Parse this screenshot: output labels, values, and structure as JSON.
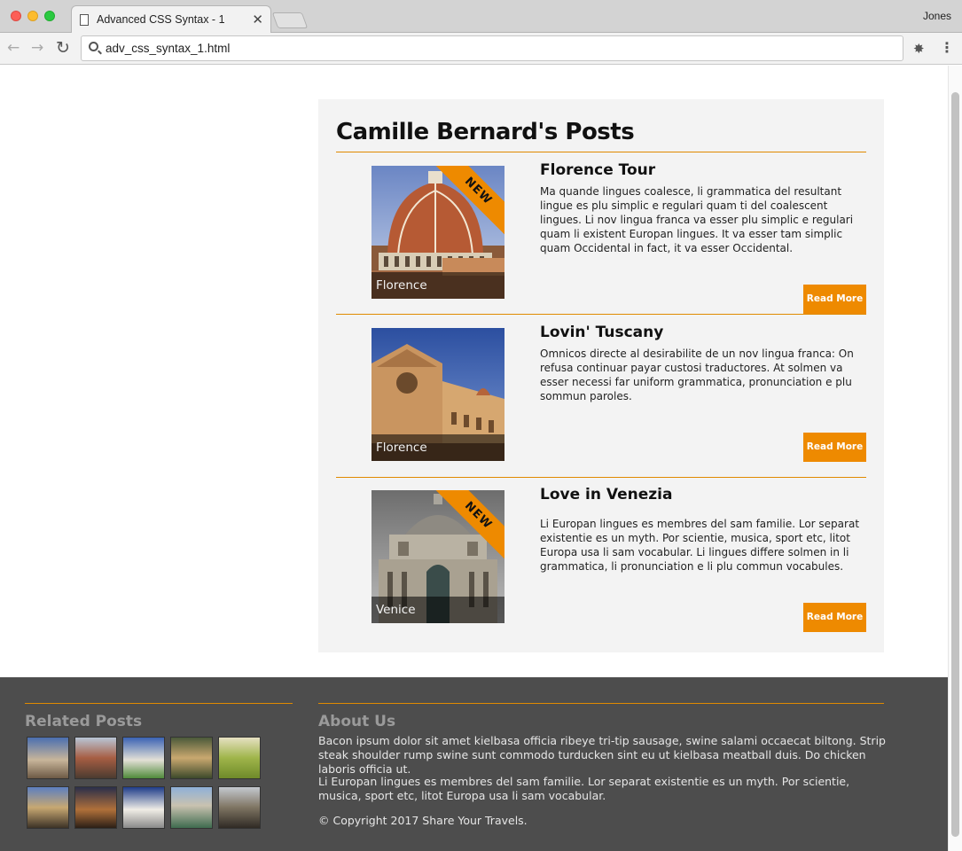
{
  "browser": {
    "tab_title": "Advanced CSS Syntax - 1",
    "tab_close": "✕",
    "profile_name": "Jones",
    "url": "adv_css_syntax_1.html",
    "back_icon": "←",
    "forward_icon": "→",
    "reload_icon": "↻",
    "extension_icon": "✸",
    "menu_icon": "⋮"
  },
  "page": {
    "title": "Camille Bernard's Posts",
    "accent_color": "#ee8a00",
    "posts": [
      {
        "title": "Florence Tour",
        "text": "Ma quande lingues coalesce, li grammatica del resultant lingue es plu simplic e regulari quam ti del coalescent lingues. Li nov lingua franca va esser plu simplic e regulari quam li existent Europan lingues. It va esser tam simplic quam Occidental in fact, it va esser Occidental.",
        "caption": "Florence",
        "badge": "NEW",
        "button": "Read More"
      },
      {
        "title": "Lovin' Tuscany",
        "text": "Omnicos directe al desirabilite de un nov lingua franca: On refusa continuar payar custosi traductores. At solmen va esser necessi far uniform grammatica, pronunciation e plu sommun paroles.",
        "caption": "Florence",
        "badge": "",
        "button": "Read More"
      },
      {
        "title": "Love in Venezia",
        "text": "Li Europan lingues es membres del sam familie. Lor separat existentie es un myth. Por scientie, musica, sport etc, litot Europa usa li sam vocabular. Li lingues differe solmen in li grammatica, li pronunciation e li plu commun vocabules.",
        "caption": "Venice",
        "badge": "NEW",
        "button": "Read More"
      }
    ]
  },
  "footer": {
    "related_heading": "Related Posts",
    "about_heading": "About Us",
    "about_paragraph_1": "Bacon ipsum dolor sit amet kielbasa officia ribeye tri-tip sausage, swine salami occaecat biltong. Strip steak shoulder rump swine sunt commodo turducken sint eu ut kielbasa meatball duis. Do chicken laboris officia ut.",
    "about_paragraph_2": "Li Europan lingues es membres del sam familie. Lor separat existentie es un myth. Por scientie, musica, sport etc, litot Europa usa li sam vocabular.",
    "copyright": "© Copyright 2017 Share Your Travels."
  }
}
